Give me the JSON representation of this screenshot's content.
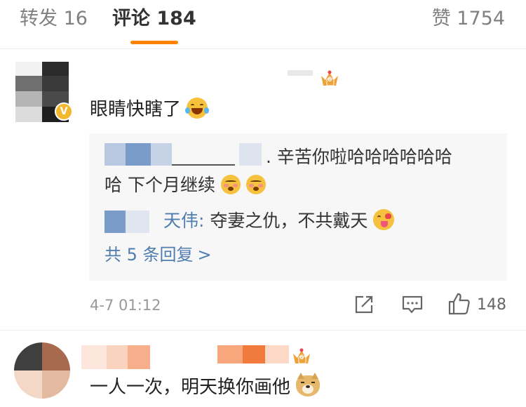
{
  "tabs": {
    "repost": "转发 16",
    "comment": "评论 184",
    "like": "赞 1754"
  },
  "colors": {
    "accent": "#ff8200",
    "link": "#507daf",
    "vip_badge": "#f2b82e"
  },
  "comment1": {
    "text": "眼睛快瞎了",
    "emoji": "laugh-cry-emoji",
    "replies": [
      {
        "line1": ". 辛苦你啦哈哈哈哈哈哈",
        "line2": "哈 下个月继续",
        "emojis": [
          "shy-emoji",
          "shy-emoji"
        ]
      },
      {
        "user": "天伟:",
        "text": "夺妻之仇，不共戴天",
        "emoji": "yum-emoji"
      }
    ],
    "more_replies": "共 5 条回复",
    "more_chevron": ">",
    "time": "4-7 01:12",
    "like_count": "148",
    "icons": {
      "share": "share-icon",
      "comment": "comment-icon",
      "like": "thumb-up-icon"
    }
  },
  "comment2": {
    "text": "一人一次，明天换你画他",
    "emoji": "doge-emoji"
  }
}
